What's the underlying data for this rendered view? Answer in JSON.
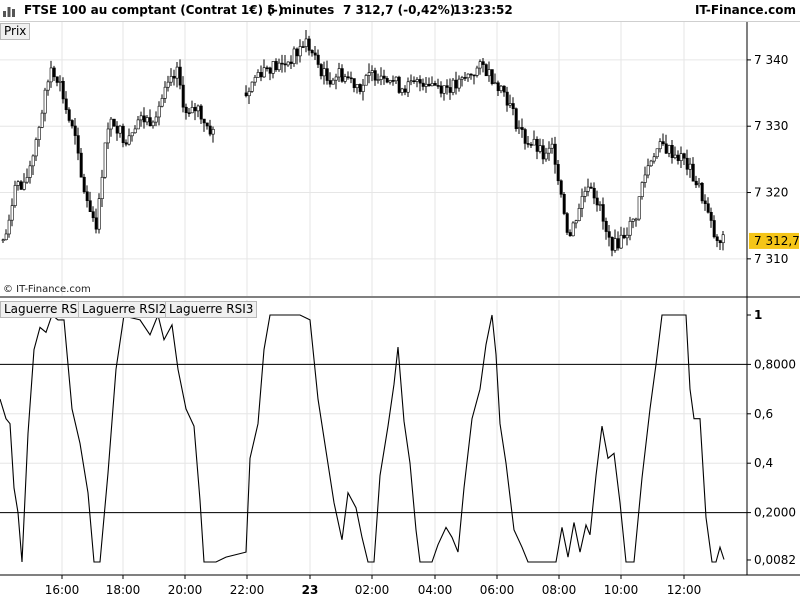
{
  "header": {
    "title": "FTSE 100 au comptant (Contrat 1€) (-)",
    "timeframe": "5 minutes",
    "price": "7 312,7 (-0,42%)",
    "time": "13:23:52",
    "brand": "IT-Finance.com"
  },
  "panels": {
    "price_label": "Prix",
    "indicator_labels": [
      "Laguerre RSI",
      "Laguerre RSI2",
      "Laguerre RSI3"
    ],
    "watermark": "© IT-Finance.com"
  },
  "colors": {
    "grid": "#e6e6e6",
    "candle": "#000000",
    "last_price_bg": "#f5c518"
  },
  "chart_data": [
    {
      "type": "candlestick",
      "title": "",
      "x_ticks": [
        "16:00",
        "18:00",
        "20:00",
        "22:00",
        "23",
        "02:00",
        "04:00",
        "06:00",
        "08:00",
        "10:00",
        "12:00"
      ],
      "y_ticks": [
        "7 340",
        "7 330",
        "7 320",
        "7 310"
      ],
      "ylim": [
        7305,
        7343
      ],
      "last_price": 7312.7,
      "last_price_label": "7 312,7",
      "close_series": [
        {
          "x": 0,
          "y": 7312
        },
        {
          "x": 8,
          "y": 7315
        },
        {
          "x": 14,
          "y": 7322
        },
        {
          "x": 22,
          "y": 7320
        },
        {
          "x": 32,
          "y": 7326
        },
        {
          "x": 42,
          "y": 7333
        },
        {
          "x": 50,
          "y": 7339
        },
        {
          "x": 58,
          "y": 7337
        },
        {
          "x": 66,
          "y": 7332
        },
        {
          "x": 74,
          "y": 7328
        },
        {
          "x": 80,
          "y": 7322
        },
        {
          "x": 88,
          "y": 7318
        },
        {
          "x": 96,
          "y": 7315
        },
        {
          "x": 104,
          "y": 7328
        },
        {
          "x": 112,
          "y": 7331
        },
        {
          "x": 124,
          "y": 7328
        },
        {
          "x": 136,
          "y": 7331
        },
        {
          "x": 150,
          "y": 7331
        },
        {
          "x": 164,
          "y": 7335
        },
        {
          "x": 176,
          "y": 7338
        },
        {
          "x": 186,
          "y": 7331
        },
        {
          "x": 196,
          "y": 7333
        },
        {
          "x": 206,
          "y": 7330
        },
        {
          "x": 212,
          "y": 7329
        },
        {
          "x": 246,
          "y": 7335
        },
        {
          "x": 256,
          "y": 7338
        },
        {
          "x": 266,
          "y": 7339
        },
        {
          "x": 280,
          "y": 7339
        },
        {
          "x": 296,
          "y": 7341
        },
        {
          "x": 304,
          "y": 7343
        },
        {
          "x": 314,
          "y": 7340
        },
        {
          "x": 326,
          "y": 7337
        },
        {
          "x": 338,
          "y": 7338
        },
        {
          "x": 350,
          "y": 7337
        },
        {
          "x": 360,
          "y": 7336
        },
        {
          "x": 372,
          "y": 7338
        },
        {
          "x": 384,
          "y": 7338
        },
        {
          "x": 398,
          "y": 7336
        },
        {
          "x": 410,
          "y": 7336
        },
        {
          "x": 424,
          "y": 7337
        },
        {
          "x": 440,
          "y": 7336
        },
        {
          "x": 456,
          "y": 7336
        },
        {
          "x": 470,
          "y": 7338
        },
        {
          "x": 482,
          "y": 7339
        },
        {
          "x": 494,
          "y": 7337
        },
        {
          "x": 504,
          "y": 7335
        },
        {
          "x": 514,
          "y": 7331
        },
        {
          "x": 524,
          "y": 7328
        },
        {
          "x": 534,
          "y": 7327
        },
        {
          "x": 544,
          "y": 7325
        },
        {
          "x": 552,
          "y": 7327
        },
        {
          "x": 560,
          "y": 7320
        },
        {
          "x": 568,
          "y": 7313
        },
        {
          "x": 578,
          "y": 7318
        },
        {
          "x": 588,
          "y": 7322
        },
        {
          "x": 598,
          "y": 7318
        },
        {
          "x": 606,
          "y": 7313
        },
        {
          "x": 614,
          "y": 7312
        },
        {
          "x": 624,
          "y": 7314
        },
        {
          "x": 634,
          "y": 7316
        },
        {
          "x": 642,
          "y": 7322
        },
        {
          "x": 652,
          "y": 7326
        },
        {
          "x": 662,
          "y": 7327
        },
        {
          "x": 672,
          "y": 7326
        },
        {
          "x": 682,
          "y": 7325
        },
        {
          "x": 690,
          "y": 7323
        },
        {
          "x": 700,
          "y": 7320
        },
        {
          "x": 708,
          "y": 7316
        },
        {
          "x": 716,
          "y": 7312
        },
        {
          "x": 722,
          "y": 7312.7
        }
      ]
    },
    {
      "type": "line",
      "title": "",
      "y_ticks": [
        "1",
        "0,8000",
        "0,6",
        "0,4",
        "0,2000",
        "0,0082"
      ],
      "ylim": [
        0,
        1
      ],
      "hlines": [
        0.8,
        0.2
      ],
      "last_value": 0.0082,
      "series": [
        {
          "name": "Laguerre RSI",
          "points": [
            {
              "x": 0,
              "y": 0.66
            },
            {
              "x": 6,
              "y": 0.58
            },
            {
              "x": 10,
              "y": 0.56
            },
            {
              "x": 14,
              "y": 0.3
            },
            {
              "x": 18,
              "y": 0.2
            },
            {
              "x": 22,
              "y": 0
            },
            {
              "x": 28,
              "y": 0.52
            },
            {
              "x": 34,
              "y": 0.86
            },
            {
              "x": 40,
              "y": 0.95
            },
            {
              "x": 46,
              "y": 0.93
            },
            {
              "x": 52,
              "y": 1
            },
            {
              "x": 58,
              "y": 0.98
            },
            {
              "x": 64,
              "y": 0.98
            },
            {
              "x": 72,
              "y": 0.62
            },
            {
              "x": 80,
              "y": 0.48
            },
            {
              "x": 88,
              "y": 0.28
            },
            {
              "x": 94,
              "y": 0
            },
            {
              "x": 100,
              "y": 0
            },
            {
              "x": 108,
              "y": 0.36
            },
            {
              "x": 116,
              "y": 0.78
            },
            {
              "x": 124,
              "y": 1
            },
            {
              "x": 130,
              "y": 0.99
            },
            {
              "x": 140,
              "y": 0.98
            },
            {
              "x": 150,
              "y": 0.92
            },
            {
              "x": 158,
              "y": 1
            },
            {
              "x": 164,
              "y": 0.9
            },
            {
              "x": 172,
              "y": 0.96
            },
            {
              "x": 178,
              "y": 0.78
            },
            {
              "x": 186,
              "y": 0.62
            },
            {
              "x": 194,
              "y": 0.55
            },
            {
              "x": 200,
              "y": 0.25
            },
            {
              "x": 204,
              "y": 0
            },
            {
              "x": 216,
              "y": 0
            },
            {
              "x": 226,
              "y": 0.02
            },
            {
              "x": 236,
              "y": 0.03
            },
            {
              "x": 246,
              "y": 0.04
            },
            {
              "x": 250,
              "y": 0.42
            },
            {
              "x": 258,
              "y": 0.56
            },
            {
              "x": 264,
              "y": 0.86
            },
            {
              "x": 270,
              "y": 1
            },
            {
              "x": 282,
              "y": 1
            },
            {
              "x": 300,
              "y": 1
            },
            {
              "x": 310,
              "y": 0.98
            },
            {
              "x": 318,
              "y": 0.66
            },
            {
              "x": 326,
              "y": 0.45
            },
            {
              "x": 334,
              "y": 0.24
            },
            {
              "x": 342,
              "y": 0.09
            },
            {
              "x": 348,
              "y": 0.28
            },
            {
              "x": 356,
              "y": 0.22
            },
            {
              "x": 362,
              "y": 0.1
            },
            {
              "x": 368,
              "y": 0
            },
            {
              "x": 374,
              "y": 0
            },
            {
              "x": 380,
              "y": 0.35
            },
            {
              "x": 388,
              "y": 0.55
            },
            {
              "x": 394,
              "y": 0.72
            },
            {
              "x": 398,
              "y": 0.87
            },
            {
              "x": 404,
              "y": 0.57
            },
            {
              "x": 410,
              "y": 0.4
            },
            {
              "x": 416,
              "y": 0.13
            },
            {
              "x": 420,
              "y": 0
            },
            {
              "x": 432,
              "y": 0
            },
            {
              "x": 438,
              "y": 0.07
            },
            {
              "x": 446,
              "y": 0.14
            },
            {
              "x": 452,
              "y": 0.1
            },
            {
              "x": 458,
              "y": 0.04
            },
            {
              "x": 464,
              "y": 0.3
            },
            {
              "x": 472,
              "y": 0.58
            },
            {
              "x": 480,
              "y": 0.7
            },
            {
              "x": 486,
              "y": 0.88
            },
            {
              "x": 492,
              "y": 1
            },
            {
              "x": 496,
              "y": 0.84
            },
            {
              "x": 500,
              "y": 0.56
            },
            {
              "x": 506,
              "y": 0.4
            },
            {
              "x": 514,
              "y": 0.13
            },
            {
              "x": 522,
              "y": 0.06
            },
            {
              "x": 528,
              "y": 0
            },
            {
              "x": 540,
              "y": 0
            },
            {
              "x": 556,
              "y": 0
            },
            {
              "x": 562,
              "y": 0.14
            },
            {
              "x": 568,
              "y": 0.02
            },
            {
              "x": 574,
              "y": 0.16
            },
            {
              "x": 580,
              "y": 0.04
            },
            {
              "x": 586,
              "y": 0.15
            },
            {
              "x": 590,
              "y": 0.11
            },
            {
              "x": 596,
              "y": 0.35
            },
            {
              "x": 602,
              "y": 0.55
            },
            {
              "x": 608,
              "y": 0.42
            },
            {
              "x": 614,
              "y": 0.44
            },
            {
              "x": 620,
              "y": 0.24
            },
            {
              "x": 626,
              "y": 0
            },
            {
              "x": 634,
              "y": 0
            },
            {
              "x": 642,
              "y": 0.34
            },
            {
              "x": 650,
              "y": 0.62
            },
            {
              "x": 656,
              "y": 0.8
            },
            {
              "x": 662,
              "y": 1
            },
            {
              "x": 672,
              "y": 1
            },
            {
              "x": 686,
              "y": 1
            },
            {
              "x": 690,
              "y": 0.7
            },
            {
              "x": 694,
              "y": 0.58
            },
            {
              "x": 700,
              "y": 0.58
            },
            {
              "x": 706,
              "y": 0.18
            },
            {
              "x": 712,
              "y": 0
            },
            {
              "x": 716,
              "y": 0
            },
            {
              "x": 720,
              "y": 0.06
            },
            {
              "x": 724,
              "y": 0.01
            }
          ]
        }
      ]
    }
  ]
}
